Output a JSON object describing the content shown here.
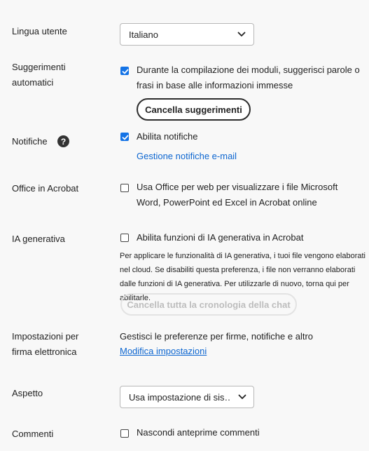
{
  "language": {
    "label": "Lingua utente",
    "value": "Italiano"
  },
  "autosuggest": {
    "label": "Suggerimenti automatici",
    "checkbox_label": "Durante la compilazione dei moduli, suggerisci parole o frasi in base alle informazioni immesse",
    "checked": true,
    "clear_button": "Cancella suggerimenti"
  },
  "notifications": {
    "label": "Notifiche",
    "help_icon": "?",
    "checkbox_label": "Abilita notifiche",
    "checked": true,
    "email_link": "Gestione notifiche e-mail"
  },
  "office": {
    "label": "Office in Acrobat",
    "checkbox_label": "Usa Office per web per visualizzare i file Microsoft Word, PowerPoint ed Excel in Acrobat online",
    "checked": false
  },
  "genai": {
    "label": "IA generativa",
    "checkbox_label": "Abilita funzioni di IA generativa in Acrobat",
    "checked": false,
    "description": "Per applicare le funzionalità di IA generativa, i tuoi file vengono elaborati nel cloud. Se disabiliti questa preferenza, i file non verranno elaborati dalle funzioni di IA generativa. Per utilizzarle di nuovo, torna qui per abilitarle.",
    "clear_history_button": "Cancella tutta la cronologia della chat"
  },
  "esign": {
    "label": "Impostazioni per firma elettronica",
    "text": "Gestisci le preferenze per firme, notifiche e altro",
    "link": "Modifica impostazioni"
  },
  "appearance": {
    "label": "Aspetto",
    "value": "Usa impostazione di sis…"
  },
  "comments": {
    "label": "Commenti",
    "checkbox_label": "Nascondi anteprime commenti",
    "checked": false
  },
  "colors": {
    "accent": "#1473e6",
    "link": "#0d66d0"
  }
}
